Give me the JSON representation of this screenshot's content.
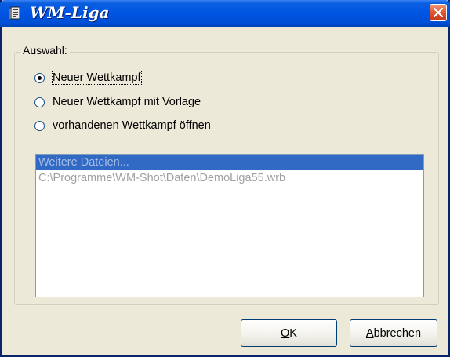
{
  "window": {
    "title": "WM-Liga",
    "app_icon": "document-icon",
    "close_icon": "close-icon",
    "titlebar_color": "#0054e3",
    "close_color": "#e35a34"
  },
  "group": {
    "label": "Auswahl:",
    "options": [
      {
        "label": "Neuer Wettkampf",
        "selected": true
      },
      {
        "label": "Neuer Wettkampf mit Vorlage",
        "selected": false
      },
      {
        "label": "vorhandenen Wettkampf öffnen",
        "selected": false
      }
    ]
  },
  "file_list": {
    "items": [
      {
        "text": "Weitere Dateien...",
        "selected": true
      },
      {
        "text": "C:\\Programme\\WM-Shot\\Daten\\DemoLiga55.wrb",
        "selected": false
      }
    ],
    "selection_color": "#316ac5"
  },
  "buttons": {
    "ok_label": "OK",
    "cancel_label": "Abbrechen"
  }
}
